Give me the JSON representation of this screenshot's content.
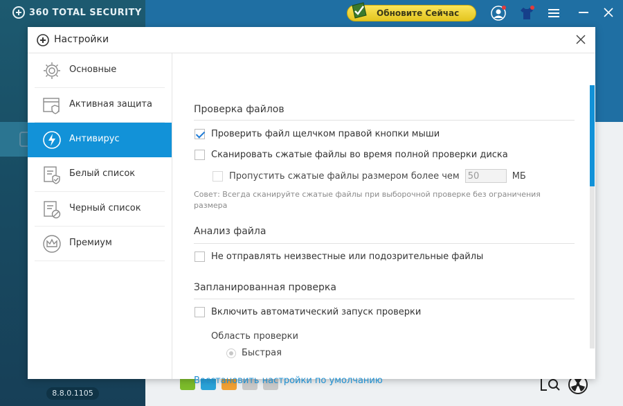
{
  "app": {
    "brand": "360 TOTAL SECURITY",
    "version": "8.8.0.1105",
    "upgrade_label": "Обновите Сейчас"
  },
  "dialog": {
    "title": "Настройки",
    "nav": [
      {
        "label": "Основные",
        "icon": "gear-icon",
        "active": false
      },
      {
        "label": "Активная защита",
        "icon": "shield-window-icon",
        "active": false
      },
      {
        "label": "Антивирус",
        "icon": "lightning-icon",
        "active": true
      },
      {
        "label": "Белый список",
        "icon": "whitelist-icon",
        "active": false
      },
      {
        "label": "Черный список",
        "icon": "blacklist-icon",
        "active": false
      },
      {
        "label": "Премиум",
        "icon": "crown-icon",
        "active": false
      }
    ],
    "sections": {
      "file_scan": {
        "title": "Проверка файлов",
        "opt_right_click": {
          "label": "Проверить файл щелчком правой кнопки мыши",
          "checked": true
        },
        "opt_compressed": {
          "label": "Сканировать сжатые файлы во время полной проверки диска",
          "checked": false
        },
        "opt_skip_large": {
          "label": "Пропустить сжатые файлы размером более чем",
          "checked": false,
          "value": "50",
          "unit": "МБ"
        },
        "hint": "Совет: Всегда сканируйте сжатые файлы при выборочной проверке без ограничения размера"
      },
      "file_analysis": {
        "title": "Анализ файла",
        "opt_no_send": {
          "label": "Не отправлять неизвестные или подозрительные файлы",
          "checked": false
        }
      },
      "scheduled": {
        "title": "Запланированная проверка",
        "opt_auto": {
          "label": "Включить автоматический запуск проверки",
          "checked": false
        },
        "area_label": "Область проверки",
        "radio_quick": "Быстрая"
      }
    },
    "restore_link": "Восстановить настройки по умолчанию"
  },
  "colors": {
    "accent": "#1292d8",
    "sidebar_bg": "#184c63",
    "topbar_bg": "#1f6fa3",
    "upgrade_yellow": "#f2d634",
    "link": "#1f8fd0"
  }
}
